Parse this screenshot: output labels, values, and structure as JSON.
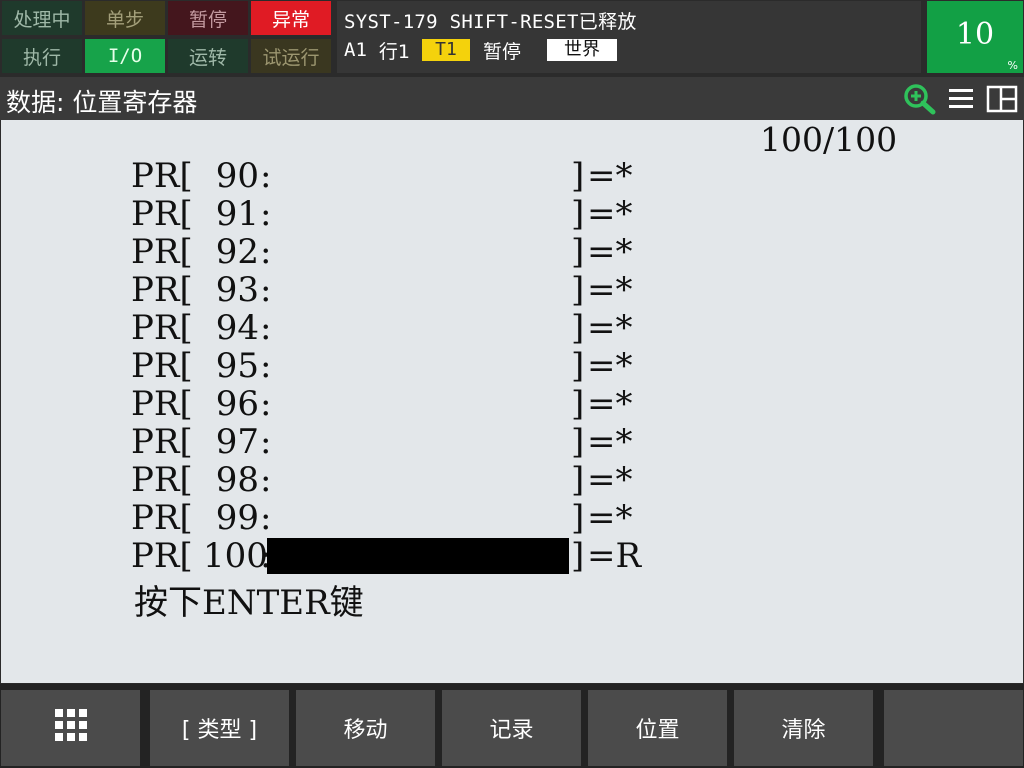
{
  "status": {
    "row1": [
      "处理中",
      "单步",
      "暂停",
      "异常"
    ],
    "row2": [
      "执行",
      "I/O",
      "运转",
      "试运行"
    ]
  },
  "message": {
    "line1": "SYST-179 SHIFT-RESET已释放",
    "group": "A1",
    "line": "行1",
    "tool": "T1",
    "state": "暂停",
    "coord": "世界"
  },
  "speed": {
    "value": "10",
    "unit": "%"
  },
  "title": "数据: 位置寄存器",
  "icons": {
    "zoom": "zoom-in-icon",
    "menu": "menu-icon",
    "layout": "split-view-icon"
  },
  "colors": {
    "abnormal": "#e01b24",
    "ok": "#17a34a",
    "tool_badge": "#f4d20c"
  },
  "register": {
    "counter": "100/100",
    "rows": [
      {
        "label": "PR[",
        "num": "90",
        "colon": ":",
        "close": "]",
        "value": "=*"
      },
      {
        "label": "PR[",
        "num": "91",
        "colon": ":",
        "close": "]",
        "value": "=*"
      },
      {
        "label": "PR[",
        "num": "92",
        "colon": ":",
        "close": "]",
        "value": "=*"
      },
      {
        "label": "PR[",
        "num": "93",
        "colon": ":",
        "close": "]",
        "value": "=*"
      },
      {
        "label": "PR[",
        "num": "94",
        "colon": ":",
        "close": "]",
        "value": "=*"
      },
      {
        "label": "PR[",
        "num": "95",
        "colon": ":",
        "close": "]",
        "value": "=*"
      },
      {
        "label": "PR[",
        "num": "96",
        "colon": ":",
        "close": "]",
        "value": "=*"
      },
      {
        "label": "PR[",
        "num": "97",
        "colon": ":",
        "close": "]",
        "value": "=*"
      },
      {
        "label": "PR[",
        "num": "98",
        "colon": ":",
        "close": "]",
        "value": "=*"
      },
      {
        "label": "PR[",
        "num": "99",
        "colon": ":",
        "close": "]",
        "value": "=*"
      },
      {
        "label": "PR[",
        "num": "100",
        "colon": ":",
        "close": "]",
        "value": "=R"
      }
    ],
    "prompt": "按下ENTER键"
  },
  "softkeys": [
    "",
    "[ 类型 ]",
    "移动",
    "记录",
    "位置",
    "清除",
    ""
  ]
}
